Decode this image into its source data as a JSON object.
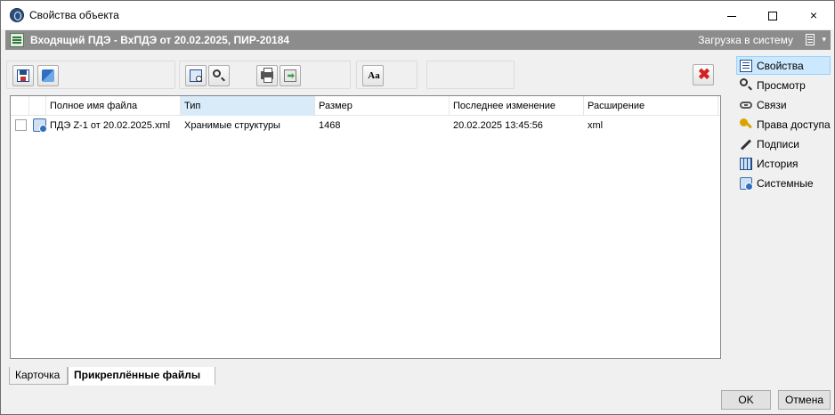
{
  "window": {
    "title": "Свойства объекта",
    "controls": {
      "minimize": "minimize",
      "maximize": "maximize",
      "close": "×"
    }
  },
  "header": {
    "title": "Входящий ПДЭ - ВхПДЭ от 20.02.2025, ПИР-20184",
    "action": "Загрузка в систему",
    "caret": "▾"
  },
  "toolbar": {
    "buttons": [
      {
        "icon": "save-to-disk-icon"
      },
      {
        "icon": "upload-icon"
      },
      {
        "icon": "preview-icon"
      },
      {
        "icon": "search-icon"
      },
      {
        "icon": "print-icon"
      },
      {
        "icon": "export-icon"
      },
      {
        "icon": "font-icon",
        "label": "Aa"
      },
      {
        "icon": "delete-icon",
        "label": "✖",
        "color": "#d42020"
      }
    ]
  },
  "file_list": {
    "columns": [
      "Полное имя файла",
      "Тип",
      "Размер",
      "Последнее изменение",
      "Расширение"
    ],
    "sorted_column": "Тип",
    "rows": [
      {
        "checked": false,
        "name": "ПДЭ Z-1 от 20.02.2025.xml",
        "type": "Хранимые структуры",
        "size": "1468",
        "modified": "20.02.2025 13:45:56",
        "extension": "xml"
      }
    ]
  },
  "tabs": [
    {
      "label": "Карточка",
      "active": false
    },
    {
      "label": "Прикреплённые файлы",
      "active": true
    }
  ],
  "side_panel": {
    "items": [
      {
        "label": "Свойства",
        "icon": "properties-icon",
        "active": true
      },
      {
        "label": "Просмотр",
        "icon": "view-icon",
        "active": false
      },
      {
        "label": "Связи",
        "icon": "links-icon",
        "active": false
      },
      {
        "label": "Права доступа",
        "icon": "key-icon",
        "active": false
      },
      {
        "label": "Подписи",
        "icon": "pen-icon",
        "active": false
      },
      {
        "label": "История",
        "icon": "history-icon",
        "active": false
      },
      {
        "label": "Системные",
        "icon": "system-icon",
        "active": false
      }
    ]
  },
  "dialog_buttons": {
    "ok": "OK",
    "cancel": "Отмена"
  },
  "colors": {
    "header_bg": "#8c8c8c",
    "selected_bg": "#cce8ff",
    "sorted_col_bg": "#d9ebf9",
    "delete_red": "#d42020"
  }
}
